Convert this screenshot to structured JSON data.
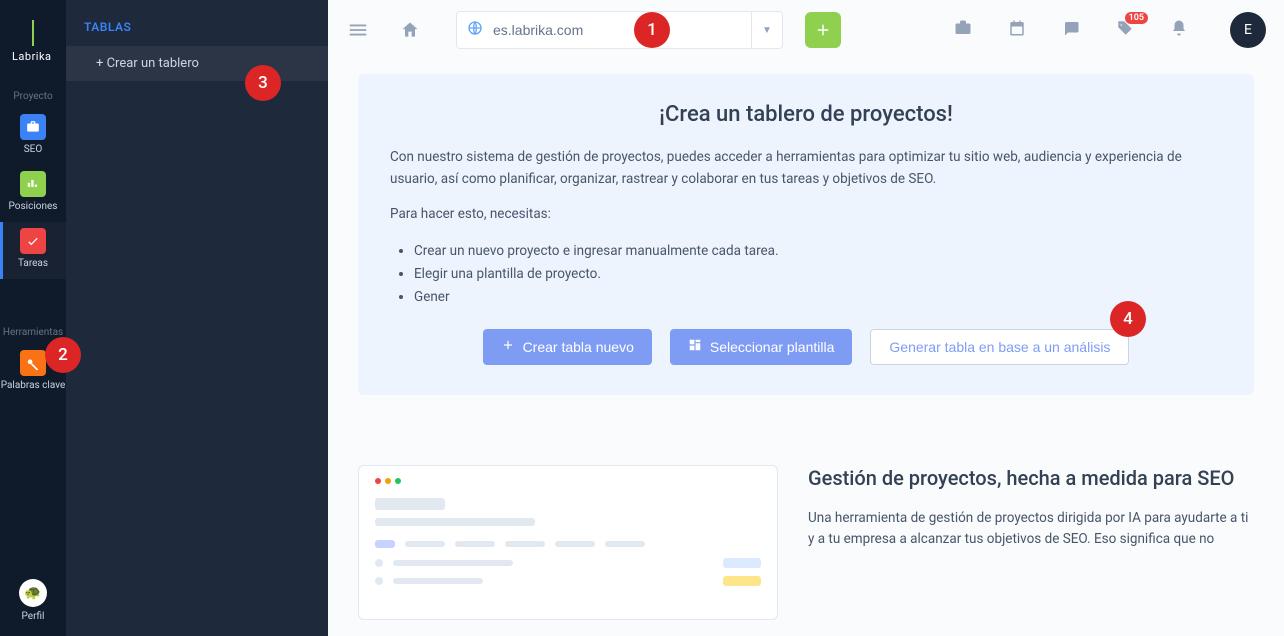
{
  "logo": "Labrika",
  "sidebar_narrow": {
    "section_project": "Proyecto",
    "section_tools": "Herramientas",
    "items": {
      "seo": "SEO",
      "positions": "Posiciones",
      "tasks": "Tareas",
      "keywords": "Palabras clave",
      "profile": "Perfil"
    }
  },
  "sidebar_wide": {
    "header": "TABLAS",
    "create_board": "+ Crear un tablero"
  },
  "topbar": {
    "domain_value": "es.labrika.com",
    "badge": "105",
    "avatar_letter": "E"
  },
  "card": {
    "title": "¡Crea un tablero de proyectos!",
    "p1": "Con nuestro sistema de gestión de proyectos, puedes acceder a herramientas para optimizar tu sitio web, audiencia y experiencia de usuario, así como planificar, organizar, rastrear y colaborar en tus tareas y objetivos de SEO.",
    "p2": "Para hacer esto, necesitas:",
    "li1": "Crear un nuevo proyecto e ingresar manualmente cada tarea.",
    "li2": "Elegir una plantilla de proyecto.",
    "li3": "Gener",
    "btn_new": "Crear tabla nuevo",
    "btn_template": "Seleccionar plantilla",
    "btn_generate": "Generar tabla en base a un análisis"
  },
  "lower": {
    "title": "Gestión de proyectos, hecha a medida para SEO",
    "body": "Una herramienta de gestión de proyectos dirigida por IA para ayudarte a ti y a tu empresa a alcanzar tus objetivos de SEO. Eso significa que no"
  },
  "callouts": [
    "1",
    "2",
    "3",
    "4"
  ]
}
